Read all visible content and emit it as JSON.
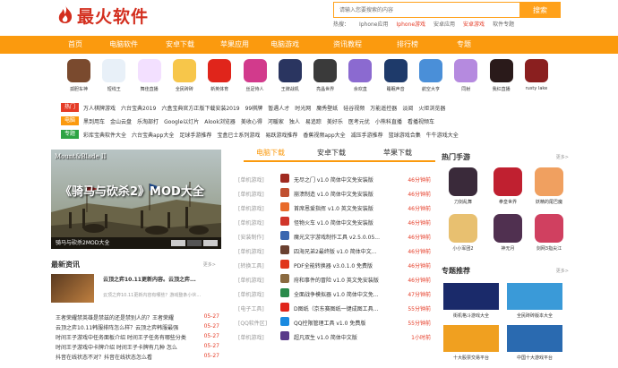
{
  "header": {
    "logo_text": "最火软件",
    "search_placeholder": "请输入您要搜索的内容",
    "search_button": "搜索",
    "hot_label": "热搜：",
    "hot_items": [
      {
        "label": "Iphone应用",
        "red": false
      },
      {
        "label": "Iphone游戏",
        "red": true
      },
      {
        "label": "安卓应用",
        "red": false
      },
      {
        "label": "安卓游戏",
        "red": true
      },
      {
        "label": "软件专题",
        "red": false
      }
    ]
  },
  "nav": [
    "首页",
    "电脑软件",
    "安卓下载",
    "苹果应用",
    "电脑游戏",
    "资讯教程",
    "排行榜",
    "专题"
  ],
  "apps": [
    {
      "label": "孤胆车神",
      "color": "#7a4a2e"
    },
    {
      "label": "短线王",
      "color": "#e8f0f8"
    },
    {
      "label": "舞佳直播",
      "color": "#f3e0ff"
    },
    {
      "label": "全民砖砖",
      "color": "#f7c64a"
    },
    {
      "label": "新英体育",
      "color": "#e0251b"
    },
    {
      "label": "丝足侍人",
      "color": "#d23a8c"
    },
    {
      "label": "王牌战机",
      "color": "#2a3560"
    },
    {
      "label": "亮晶世界",
      "color": "#3a3a3a"
    },
    {
      "label": "余欢直",
      "color": "#8b6ad0"
    },
    {
      "label": "睡眠声音",
      "color": "#1e3a6a"
    },
    {
      "label": "航空大亨",
      "color": "#4a8fd8"
    },
    {
      "label": "同射",
      "color": "#b58adf"
    },
    {
      "label": "我红直播",
      "color": "#2a1a1a"
    },
    {
      "label": "rusty lake",
      "color": "#8a1f1f"
    }
  ],
  "tag_rows": [
    {
      "tag": "热门",
      "color": "#e53c27",
      "items": [
        "万人棋牌游戏",
        "六台宝典2019",
        "六盒宝典官方正版下载安装2019",
        "99棋牌",
        "暂遇人才",
        "时光网",
        "魔秀壁纸",
        "硅谷视频",
        "万能遥控器",
        "淡阅",
        "火炬浏览器"
      ]
    },
    {
      "tag": "电脑",
      "color": "#fb9a0e",
      "items": [
        "黑到用车",
        "金山云盘",
        "乐淘部打",
        "Google以灯片",
        "Alook浏览器",
        "美收心得",
        "河暖家",
        "独人",
        "易追踪",
        "美好乐",
        "医考元优",
        "小熊科直播",
        "看播视频车"
      ]
    },
    {
      "tag": "专题",
      "color": "#2ea444",
      "items": [
        "彩库宝典软件大全",
        "六台宝典app大全",
        "足球手游推荐",
        "宝盒已士系列游戏",
        "易跃游戏推荐",
        "香蕉视频app大全",
        "减压手游推荐",
        "篮球游戏合集",
        "牛牛游戏大全"
      ]
    }
  ],
  "banner": {
    "logo": "Mount&Blade II",
    "title": "《骑马与砍杀2》MOD大全",
    "caption": "骑马与砍杀2MOD大全"
  },
  "news": {
    "title": "最新资讯",
    "more": "更多>",
    "feature_title": "云顶之弈10.11更新内容。云顶之弈...",
    "feature_desc": "云顶之弈10.11更新内容有哪些？游戏整条小伙...",
    "items": [
      {
        "t": "王者荣耀禁英雄是禁兹的还是禁别人的？王者荣耀",
        "d": "05-27"
      },
      {
        "t": "云顶之弈10.11韩服排阵怎么样？云顶之弈韩服最强",
        "d": "05-27"
      },
      {
        "t": "时间王子游戏中任务面板介绍 时间王子任务有哪些分类",
        "d": "05-27"
      },
      {
        "t": "时间王子游戏中卡牌介绍 时间王子卡牌有几种 怎么",
        "d": "05-27"
      },
      {
        "t": "抖音在线状态不对？抖音在线状态怎么看",
        "d": "05-27"
      }
    ]
  },
  "center": {
    "tabs": [
      "电脑下载",
      "安卓下载",
      "苹果下载"
    ],
    "downloads": [
      {
        "cat": "[单机游戏]",
        "name": "无尽之门 v1.0 简体中文免安装版",
        "time": "46分钟前",
        "color": "#a02a20"
      },
      {
        "cat": "[单机游戏]",
        "name": "崩溃制造 v1.0 简体中文免安装版",
        "time": "46分钟前",
        "color": "#c05030"
      },
      {
        "cat": "[单机游戏]",
        "name": "首席恩爱指挥 v1.0 英文免安装版",
        "time": "46分钟前",
        "color": "#e86a2a"
      },
      {
        "cat": "[单机游戏]",
        "name": "怪物火车 v1.0 简体中文免安装版",
        "time": "46分钟前",
        "color": "#d0352a"
      },
      {
        "cat": "[安装制作]",
        "name": "魔光文字游戏制作工具 v2.5.0.05...",
        "time": "46分钟前",
        "color": "#3a66b0"
      },
      {
        "cat": "[单机游戏]",
        "name": "四海兄弟2最终版 v1.0 简体中文...",
        "time": "46分钟前",
        "color": "#6a4030"
      },
      {
        "cat": "[转换工具]",
        "name": "PDF全能转换器 v3.0.1.0 免费版",
        "time": "46分钟前",
        "color": "#e0351b"
      },
      {
        "cat": "[单机游戏]",
        "name": "府和事件的冒险 v1.0 英文免安装版",
        "time": "46分钟前",
        "color": "#8a6a40"
      },
      {
        "cat": "[单机游戏]",
        "name": "全面战争模拟器 v1.0 简体中文免...",
        "time": "47分钟前",
        "color": "#2a8a4a"
      },
      {
        "cat": "[电子工具]",
        "name": "D图纸（京东赛图纸一键成图工具...",
        "time": "55分钟前",
        "color": "#e0251b"
      },
      {
        "cat": "[QQ软件区]",
        "name": "QQ控限管理工具 v1.0 免费版",
        "time": "55分钟前",
        "color": "#1a8ae0"
      },
      {
        "cat": "[单机游戏]",
        "name": "超凡双生 v1.0 简体中文版",
        "time": "1小时前",
        "color": "#5a3a8a"
      }
    ]
  },
  "right": {
    "hot_title": "热门手游",
    "hot_more": "更多>",
    "games": [
      {
        "label": "刀剑乱舞",
        "color": "#3a2a3a"
      },
      {
        "label": "拳皇世界",
        "color": "#c02030"
      },
      {
        "label": "妖精的尾巴魔",
        "color": "#f0a060"
      },
      {
        "label": "小小军团2",
        "color": "#e8c070"
      },
      {
        "label": "神无月",
        "color": "#503050"
      },
      {
        "label": "剑网3指尖江",
        "color": "#d04060"
      }
    ],
    "topic_title": "专题推荐",
    "topic_more": "更多>",
    "topics": [
      {
        "label": "街机格斗游戏大全",
        "color": "#1a2a6a"
      },
      {
        "label": "全民砖砖版本大全",
        "color": "#3a9ad8"
      },
      {
        "label": "十大股票交易平台",
        "color": "#f0a020"
      },
      {
        "label": "中国十大游戏平台",
        "color": "#2a6ab0"
      }
    ]
  }
}
